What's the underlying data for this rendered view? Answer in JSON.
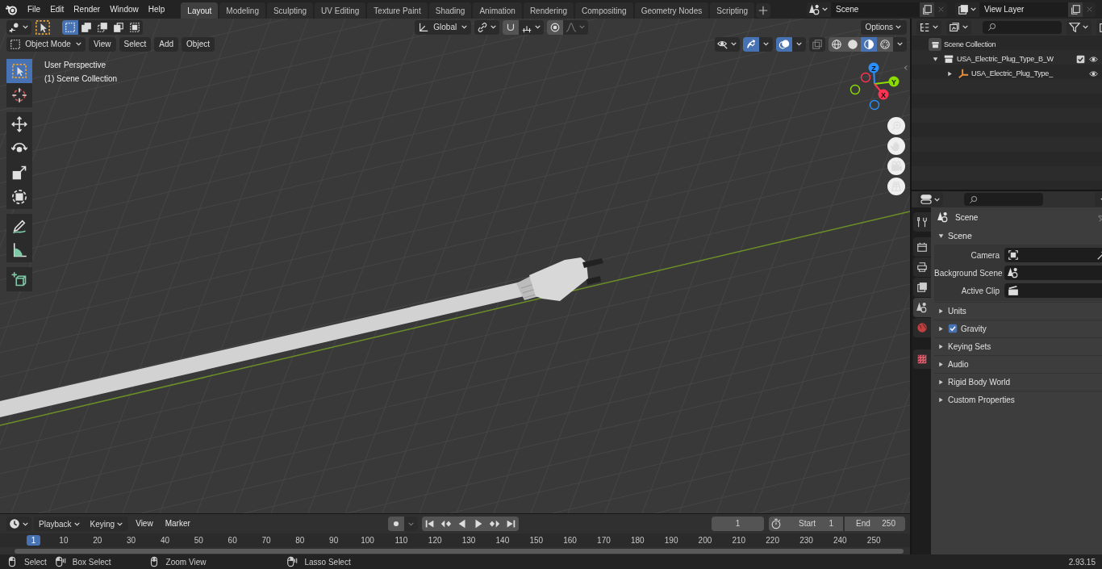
{
  "top_bar": {
    "menus": [
      "File",
      "Edit",
      "Render",
      "Window",
      "Help"
    ],
    "workspace_tabs": [
      {
        "label": "Layout",
        "selected": true
      },
      {
        "label": "Modeling",
        "selected": false
      },
      {
        "label": "Sculpting",
        "selected": false
      },
      {
        "label": "UV Editing",
        "selected": false
      },
      {
        "label": "Texture Paint",
        "selected": false
      },
      {
        "label": "Shading",
        "selected": false
      },
      {
        "label": "Animation",
        "selected": false
      },
      {
        "label": "Rendering",
        "selected": false
      },
      {
        "label": "Compositing",
        "selected": false
      },
      {
        "label": "Geometry Nodes",
        "selected": false
      },
      {
        "label": "Scripting",
        "selected": false
      }
    ],
    "scene": "Scene",
    "view_layer": "View Layer"
  },
  "viewport": {
    "select_modes": [
      {
        "kind": "set",
        "selected": true
      },
      {
        "kind": "extend",
        "selected": false
      },
      {
        "kind": "subtract",
        "selected": false
      },
      {
        "kind": "difference",
        "selected": false
      },
      {
        "kind": "intersect",
        "selected": false
      }
    ],
    "orientation": "Global",
    "options_label": "Options",
    "mode": "Object Mode",
    "menus": [
      "View",
      "Select",
      "Add",
      "Object"
    ],
    "show_gizmo": true,
    "show_overlays": true,
    "shading_modes": [
      {
        "kind": "wireframe",
        "selected": false
      },
      {
        "kind": "solid",
        "selected": false
      },
      {
        "kind": "material",
        "selected": true
      },
      {
        "kind": "rendered",
        "selected": false
      }
    ],
    "overlay_lines": [
      "User Perspective",
      "(1) Scene Collection"
    ],
    "tools": [
      {
        "kind": "select",
        "selected": true
      },
      {
        "kind": "cursor",
        "selected": false
      },
      {
        "kind": "move",
        "selected": false
      },
      {
        "kind": "rotate",
        "selected": false
      },
      {
        "kind": "scale",
        "selected": false
      },
      {
        "kind": "transform",
        "selected": false
      },
      {
        "kind": "annotate",
        "selected": false
      },
      {
        "kind": "measure",
        "selected": false
      },
      {
        "kind": "add-cube",
        "selected": false
      }
    ],
    "gizmo_axes": [
      "Z",
      "Y",
      "X"
    ]
  },
  "outliner": {
    "tree": [
      {
        "label": "Scene Collection",
        "kind": "scene-collection",
        "children": [
          {
            "label": "USA_Electric_Plug_Type_B_W",
            "kind": "collection",
            "expanded": true,
            "checked": true,
            "children": [
              {
                "label": "USA_Electric_Plug_Type_",
                "kind": "empty",
                "expanded": false
              }
            ]
          }
        ]
      }
    ]
  },
  "properties": {
    "tabs": [
      {
        "kind": "tool",
        "selected": false
      },
      {
        "kind": "render",
        "selected": false
      },
      {
        "kind": "output",
        "selected": false
      },
      {
        "kind": "view-layer",
        "selected": false
      },
      {
        "kind": "scene",
        "selected": true
      },
      {
        "kind": "world",
        "selected": false
      },
      {
        "kind": "texture",
        "selected": false
      }
    ],
    "context": "Scene",
    "panel": {
      "title": "Scene",
      "expanded": true,
      "fields": [
        {
          "label": "Camera",
          "kind": "camera"
        },
        {
          "label": "Background Scene",
          "kind": "scene"
        },
        {
          "label": "Active Clip",
          "kind": "clip"
        }
      ]
    },
    "subpanels": [
      {
        "title": "Units",
        "kind": "plain",
        "expanded": false
      },
      {
        "title": "Gravity",
        "kind": "toggle",
        "checked": true,
        "expanded": false
      },
      {
        "title": "Keying Sets",
        "kind": "plain",
        "expanded": false
      },
      {
        "title": "Audio",
        "kind": "plain",
        "expanded": false
      },
      {
        "title": "Rigid Body World",
        "kind": "plain",
        "expanded": false
      },
      {
        "title": "Custom Properties",
        "kind": "plain",
        "expanded": false
      }
    ]
  },
  "timeline": {
    "dropdowns": [
      "Playback",
      "Keying"
    ],
    "menus": [
      "View",
      "Marker"
    ],
    "current_frame": "1",
    "start_label": "Start",
    "start": "1",
    "end_label": "End",
    "end": "250",
    "playhead": "1",
    "ruler_labels": [
      "10",
      "20",
      "30",
      "40",
      "50",
      "60",
      "70",
      "80",
      "90",
      "100",
      "110",
      "120",
      "130",
      "140",
      "150",
      "160",
      "170",
      "180",
      "190",
      "200",
      "210",
      "220",
      "230",
      "240",
      "250"
    ]
  },
  "status_bar": {
    "hints": [
      {
        "kind": "left-click",
        "label": "Select"
      },
      {
        "kind": "left-drag",
        "label": "Box Select"
      },
      {
        "kind": "middle-click",
        "label": "Zoom View"
      },
      {
        "kind": "right-drag",
        "label": "Lasso Select"
      }
    ],
    "version": "2.93.15"
  }
}
